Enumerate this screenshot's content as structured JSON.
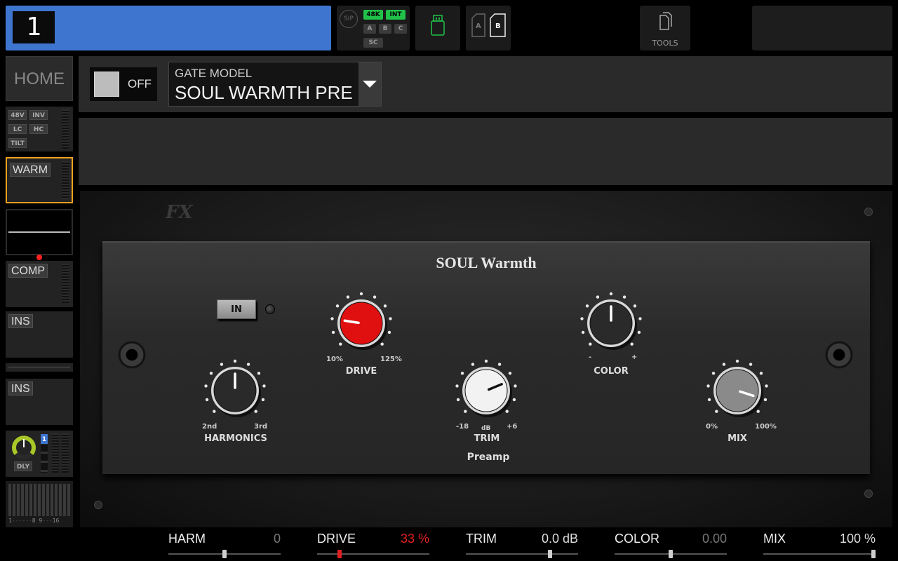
{
  "top": {
    "channel_number": "1",
    "sip_label": "SIP",
    "rate_48k": "48K",
    "int_label": "INT",
    "bus_a": "A",
    "bus_b": "B",
    "bus_c": "C",
    "sc_label": "SC",
    "card_a": "A",
    "card_b": "B",
    "tools_label": "TOOLS"
  },
  "sidebar": {
    "home": "HOME",
    "input_chips": [
      "48V",
      "INV",
      "LC",
      "HC",
      "TILT"
    ],
    "warm_label": "WARM",
    "comp_label": "COMP",
    "ins1_label": "INS",
    "ins2_label": "INS",
    "dly_label": "DLY",
    "dly_index": "1",
    "meter_scale_left": "1",
    "meter_scale_mid_a": "8",
    "meter_scale_mid_b": "9",
    "meter_scale_right": "16"
  },
  "header": {
    "toggle_label": "OFF",
    "model_caption": "GATE MODEL",
    "model_name": "SOUL WARMTH PRE"
  },
  "plugin": {
    "logo": "FX",
    "title": "SOUL Warmth",
    "in_button": "IN",
    "section_label": "Preamp",
    "knobs": {
      "harmonics": {
        "label": "HARMONICS",
        "min": "2nd",
        "max": "3rd",
        "level": 0.5,
        "color": "#2a2a2a"
      },
      "drive": {
        "label": "DRIVE",
        "min": "10%",
        "max": "125%",
        "level": 0.2,
        "color": "#e01010"
      },
      "trim": {
        "label": "TRIM",
        "min": "-18",
        "max": "+6",
        "unit": "dB",
        "level": 0.75,
        "color": "#f2f2f2"
      },
      "color": {
        "label": "COLOR",
        "min": "-",
        "max": "+",
        "level": 0.5,
        "color": "#2a2a2a"
      },
      "mix": {
        "label": "MIX",
        "min": "0%",
        "max": "100%",
        "level": 0.9,
        "color": "#8a8a8a"
      }
    }
  },
  "params": [
    {
      "name": "HARM",
      "value": "0",
      "level": 0.5,
      "value_color": "#777777"
    },
    {
      "name": "DRIVE",
      "value": "33 %",
      "level": 0.2,
      "value_color": "#e02020"
    },
    {
      "name": "TRIM",
      "value": "0.0 dB",
      "level": 0.75,
      "value_color": "#dddddd"
    },
    {
      "name": "COLOR",
      "value": "0.00",
      "level": 0.5,
      "value_color": "#777777"
    },
    {
      "name": "MIX",
      "value": "100 %",
      "level": 1.0,
      "value_color": "#dddddd"
    }
  ],
  "colors": {
    "channel_blue": "#3e76cf",
    "selected_orange": "#f0a020",
    "status_green": "#21c24a",
    "alert_red": "#ff2020"
  }
}
